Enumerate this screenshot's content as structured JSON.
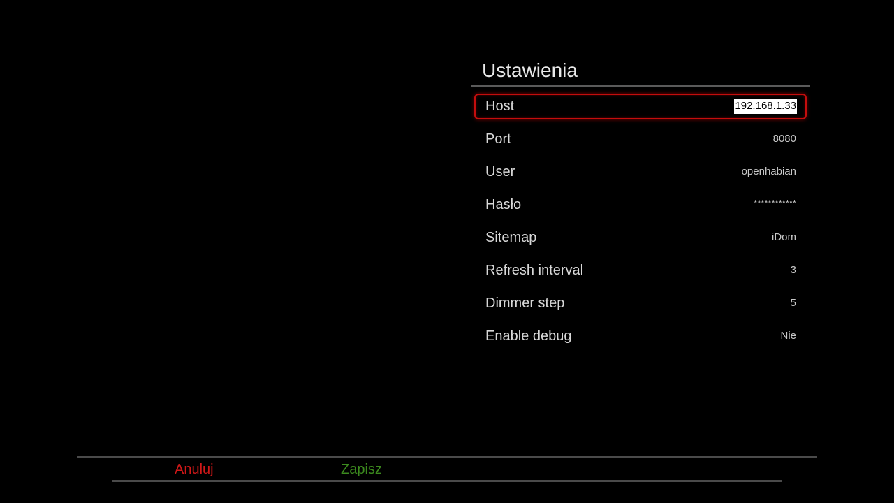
{
  "panel": {
    "title": "Ustawienia",
    "settings": [
      {
        "label": "Host",
        "value": "192.168.1.33",
        "selected": true
      },
      {
        "label": "Port",
        "value": "8080"
      },
      {
        "label": "User",
        "value": "openhabian"
      },
      {
        "label": "Hasło",
        "value": "************"
      },
      {
        "label": "Sitemap",
        "value": "iDom"
      },
      {
        "label": "Refresh interval",
        "value": "3"
      },
      {
        "label": "Dimmer step",
        "value": "5"
      },
      {
        "label": "Enable debug",
        "value": "Nie"
      }
    ]
  },
  "footer": {
    "cancel_label": "Anuluj",
    "save_label": "Zapisz"
  },
  "colors": {
    "background": "#000000",
    "selection_border": "#c40d0d",
    "cancel_red": "#d01818",
    "save_green": "#3c8a1e",
    "divider": "#5a5a5a",
    "text": "#d8d8d8"
  }
}
